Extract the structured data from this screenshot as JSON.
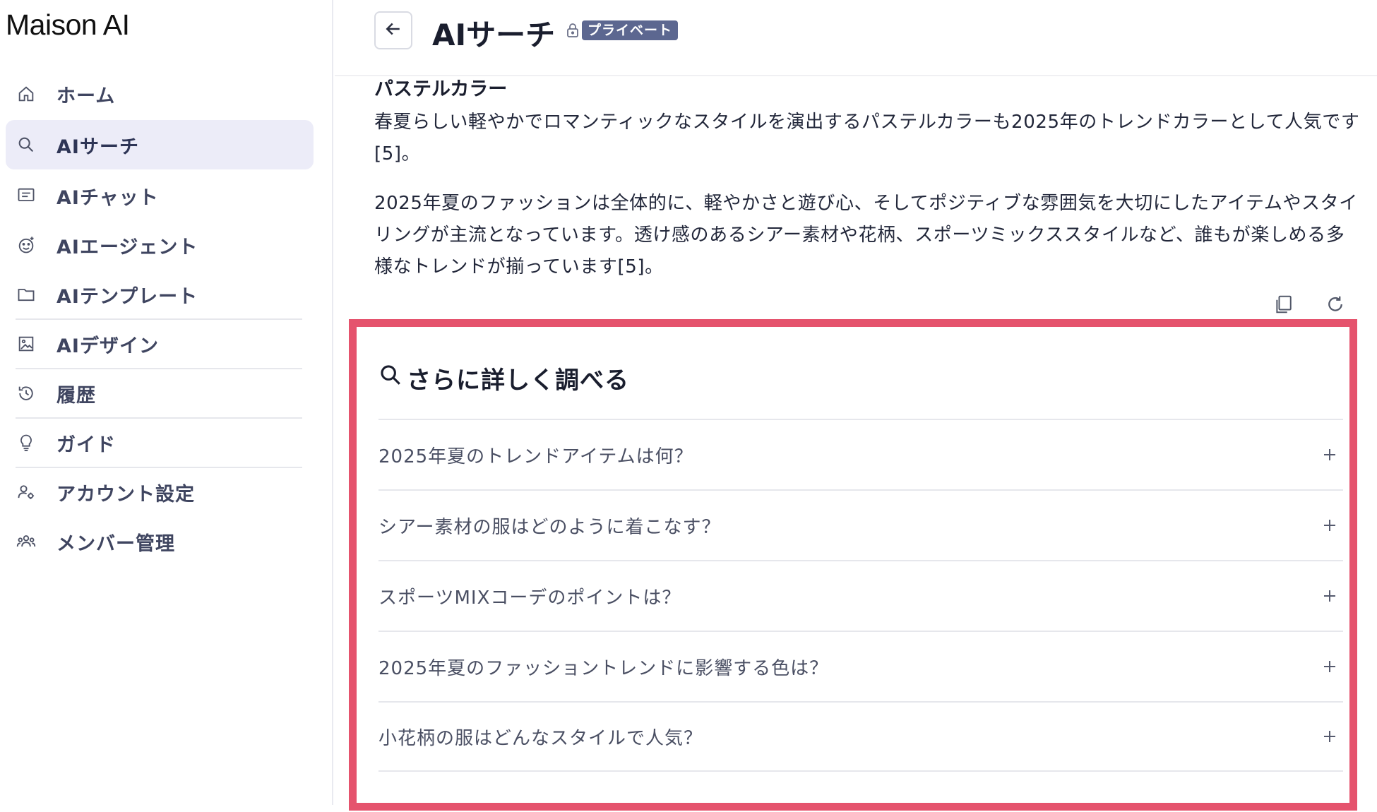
{
  "app": {
    "name": "Maison AI"
  },
  "sidebar": {
    "items": [
      {
        "label": "ホーム",
        "icon": "home-icon"
      },
      {
        "label": "AIサーチ",
        "icon": "search-icon",
        "active": true
      },
      {
        "label": "AIチャット",
        "icon": "chat-icon"
      },
      {
        "label": "AIエージェント",
        "icon": "agent-icon"
      },
      {
        "label": "AIテンプレート",
        "icon": "folder-icon"
      },
      {
        "label": "AIデザイン",
        "icon": "image-icon"
      },
      {
        "label": "履歴",
        "icon": "history-icon"
      },
      {
        "label": "ガイド",
        "icon": "lightbulb-icon"
      },
      {
        "label": "アカウント設定",
        "icon": "account-settings-icon"
      },
      {
        "label": "メンバー管理",
        "icon": "members-icon"
      }
    ]
  },
  "header": {
    "title": "AIサーチ",
    "badge": "プライベート"
  },
  "content": {
    "subheading": "パステルカラー",
    "paragraph1": "春夏らしい軽やかでロマンティックなスタイルを演出するパステルカラーも2025年のトレンドカラーとして人気です[5]。",
    "paragraph2": "2025年夏のファッションは全体的に、軽やかさと遊び心、そしてポジティブな雰囲気を大切にしたアイテムやスタイリングが主流となっています。透け感のあるシアー素材や花柄、スポーツミックススタイルなど、誰もが楽しめる多様なトレンドが揃っています[5]。"
  },
  "more": {
    "title": "さらに詳しく調べる",
    "questions": [
      "2025年夏のトレンドアイテムは何？",
      "シアー素材の服はどのように着こなす？",
      "スポーツMIXコーデのポイントは？",
      "2025年夏のファッショントレンドに影響する色は？",
      "小花柄の服はどんなスタイルで人気？"
    ]
  },
  "colors": {
    "highlight": "#e5536d",
    "badge": "#5c6790",
    "active_nav": "#ececf8"
  }
}
